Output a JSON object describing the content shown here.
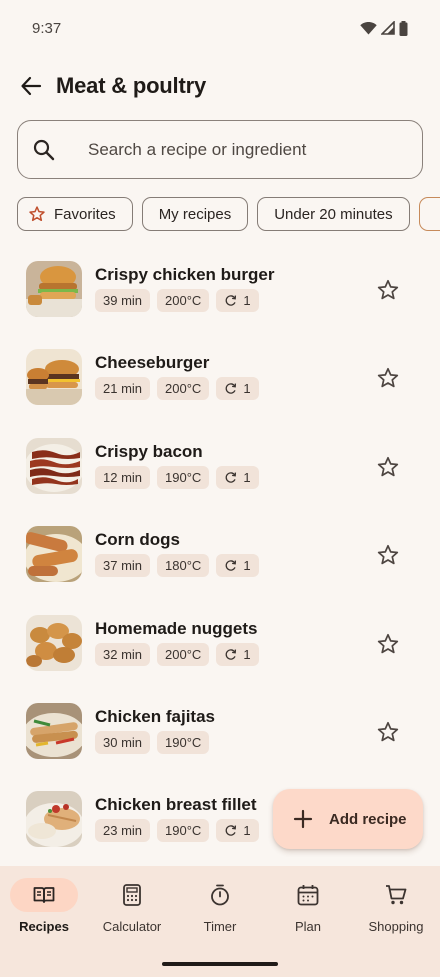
{
  "status_bar": {
    "time": "9:37"
  },
  "header": {
    "title": "Meat & poultry",
    "back_icon": "arrow-back-icon"
  },
  "search": {
    "placeholder": "Search a recipe or ingredient",
    "icon": "search-icon"
  },
  "filters": [
    {
      "label": "Favorites",
      "icon": "star-outline-icon"
    },
    {
      "label": "My recipes"
    },
    {
      "label": "Under 20 minutes"
    }
  ],
  "recipes": [
    {
      "name": "Crispy chicken burger",
      "time": "39 min",
      "temp": "200°C",
      "rounds": "1",
      "favorite_icon": "star-outline-icon"
    },
    {
      "name": "Cheeseburger",
      "time": "21 min",
      "temp": "200°C",
      "rounds": "1",
      "favorite_icon": "star-outline-icon"
    },
    {
      "name": "Crispy bacon",
      "time": "12 min",
      "temp": "190°C",
      "rounds": "1",
      "favorite_icon": "star-outline-icon"
    },
    {
      "name": "Corn dogs",
      "time": "37 min",
      "temp": "180°C",
      "rounds": "1",
      "favorite_icon": "star-outline-icon"
    },
    {
      "name": "Homemade nuggets",
      "time": "32 min",
      "temp": "200°C",
      "rounds": "1",
      "favorite_icon": "star-outline-icon"
    },
    {
      "name": "Chicken fajitas",
      "time": "30 min",
      "temp": "190°C",
      "favorite_icon": "star-outline-icon"
    },
    {
      "name": "Chicken breast fillet",
      "time": "23 min",
      "temp": "190°C",
      "rounds": "1"
    }
  ],
  "fab": {
    "label": "Add recipe",
    "icon": "plus-icon"
  },
  "bottom_nav": [
    {
      "label": "Recipes",
      "icon": "book-icon",
      "active": true
    },
    {
      "label": "Calculator",
      "icon": "calculator-icon"
    },
    {
      "label": "Timer",
      "icon": "timer-icon"
    },
    {
      "label": "Plan",
      "icon": "calendar-icon"
    },
    {
      "label": "Shopping",
      "icon": "cart-icon"
    }
  ],
  "colors": {
    "background": "#faf6f2",
    "tag_background": "#f1e3d9",
    "fab_background": "#fdd9c9",
    "nav_background": "#f6e6dc",
    "nav_active_pill": "#fdd6c4",
    "favorite_accent": "#c0502e"
  }
}
